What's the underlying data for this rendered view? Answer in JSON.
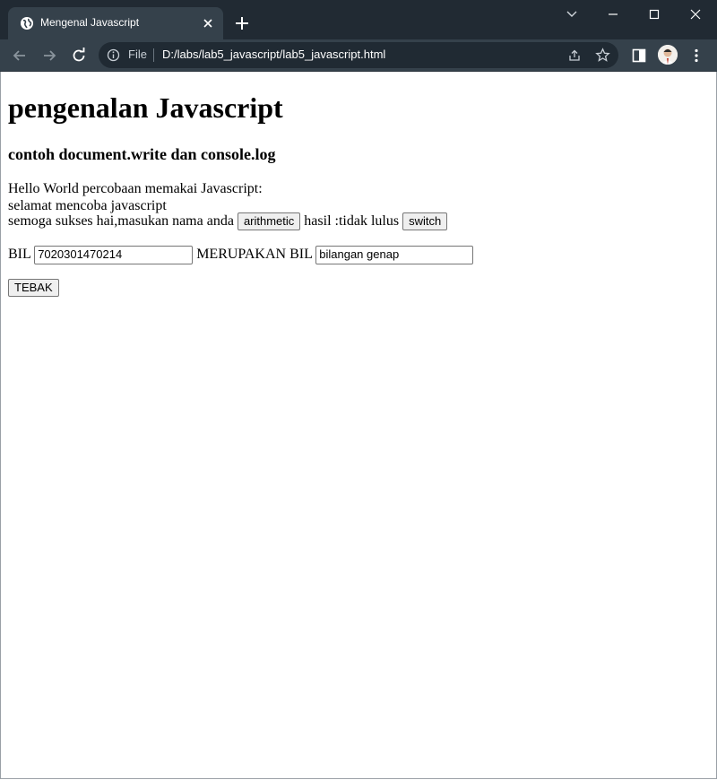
{
  "browser": {
    "tab_title": "Mengenal Javascript",
    "address_scheme_label": "File",
    "url": "D:/labs/lab5_javascript/lab5_javascript.html",
    "colors": {
      "tabstrip": "#212a33",
      "toolbar": "#35414b",
      "omnibox": "#202a33"
    }
  },
  "page": {
    "heading": "pengenalan Javascript",
    "subheading": "contoh document.write dan console.log",
    "line1": "Hello World percobaan memakai Javascript:",
    "line2": "selamat mencoba javascript",
    "line3_prefix": "semoga sukses hai,masukan nama anda",
    "arithmetic_button": "arithmetic",
    "line3_middle": "hasil :tidak lulus",
    "switch_button": "switch",
    "bil_label": "BIL",
    "bil_value": "7020301470214",
    "merupakan_label": "MERUPAKAN BIL",
    "result_value": "bilangan genap",
    "tebak_button": "TEBAK"
  }
}
